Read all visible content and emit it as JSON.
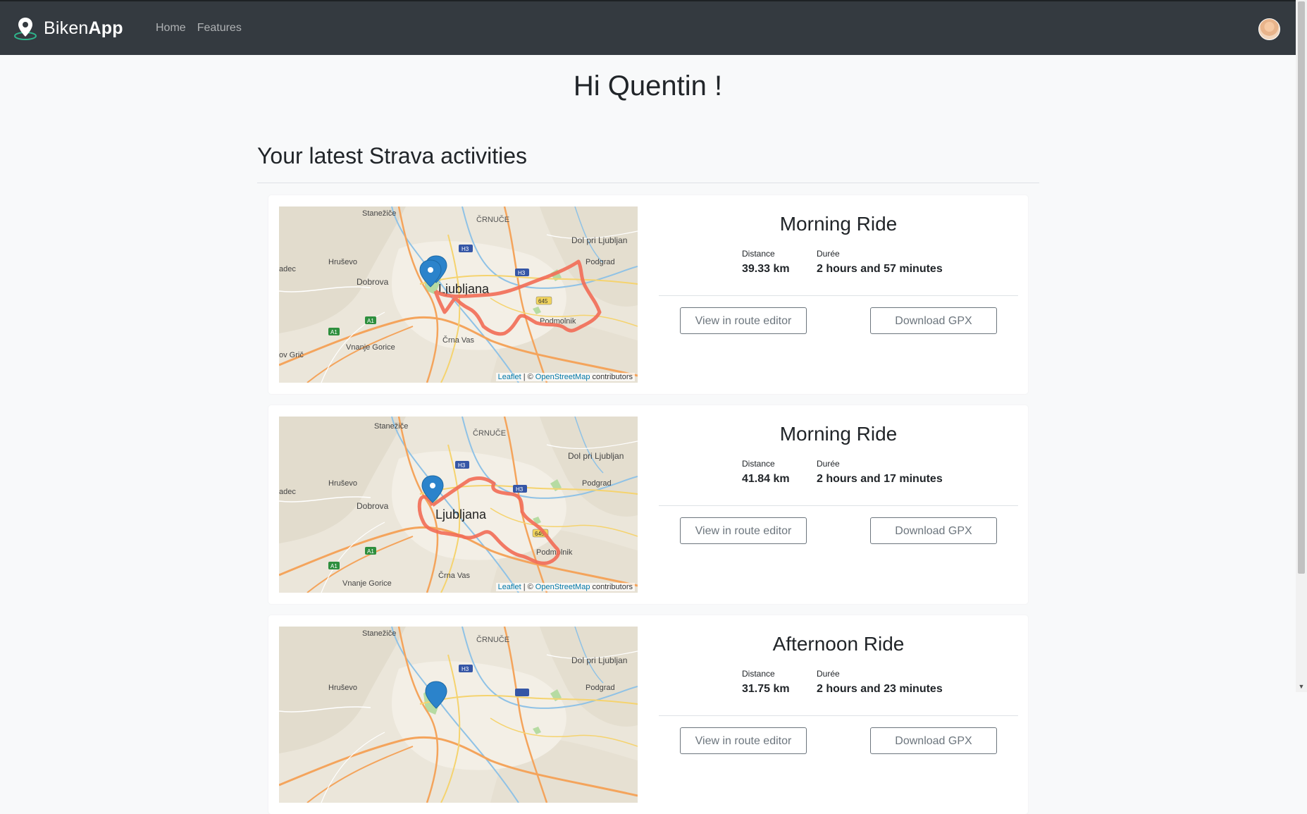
{
  "brand": {
    "name_light": "Biken",
    "name_bold": "App"
  },
  "nav": {
    "items": [
      "Home",
      "Features"
    ]
  },
  "greeting": "Hi Quentin !",
  "section_title": "Your latest Strava activities",
  "activities": [
    {
      "title": "Morning Ride",
      "distance_label": "Distance",
      "distance_value": "39.33 km",
      "duration_label": "Durée",
      "duration_value": "2 hours and 57 minutes",
      "edit_button": "View in route editor",
      "download_button": "Download GPX"
    },
    {
      "title": "Morning Ride",
      "distance_label": "Distance",
      "distance_value": "41.84 km",
      "duration_label": "Durée",
      "duration_value": "2 hours and 17 minutes",
      "edit_button": "View in route editor",
      "download_button": "Download GPX"
    },
    {
      "title": "Afternoon Ride",
      "distance_label": "Distance",
      "distance_value": "31.75 km",
      "duration_label": "Durée",
      "duration_value": "2 hours and 23 minutes",
      "edit_button": "View in route editor",
      "download_button": "Download GPX"
    }
  ],
  "map": {
    "places": {
      "stanezice": "Stanežiče",
      "crnuce": "ČRNUČE",
      "dol": "Dol pri Ljubljan",
      "hrusevo": "Hruševo",
      "dobrova": "Dobrova",
      "ljubljana": "Ljubljana",
      "podgrad": "Podgrad",
      "podmolnik": "Podmolnik",
      "crna_vas": "Črna Vas",
      "vnanje_gorice": "Vnanje Gorice",
      "gradec": "adec",
      "gric": "ov Grič",
      "h3": "H3",
      "a1": "A1",
      "r645": "645"
    },
    "attribution": {
      "leaflet": "Leaflet",
      "osm": "OpenStreetMap",
      "suffix": "contributors",
      "sep": "| ©"
    }
  },
  "colors": {
    "navbar": "#343a40",
    "route": "#f26b55",
    "marker": "#2b83cb",
    "accent": "#6c757d"
  }
}
